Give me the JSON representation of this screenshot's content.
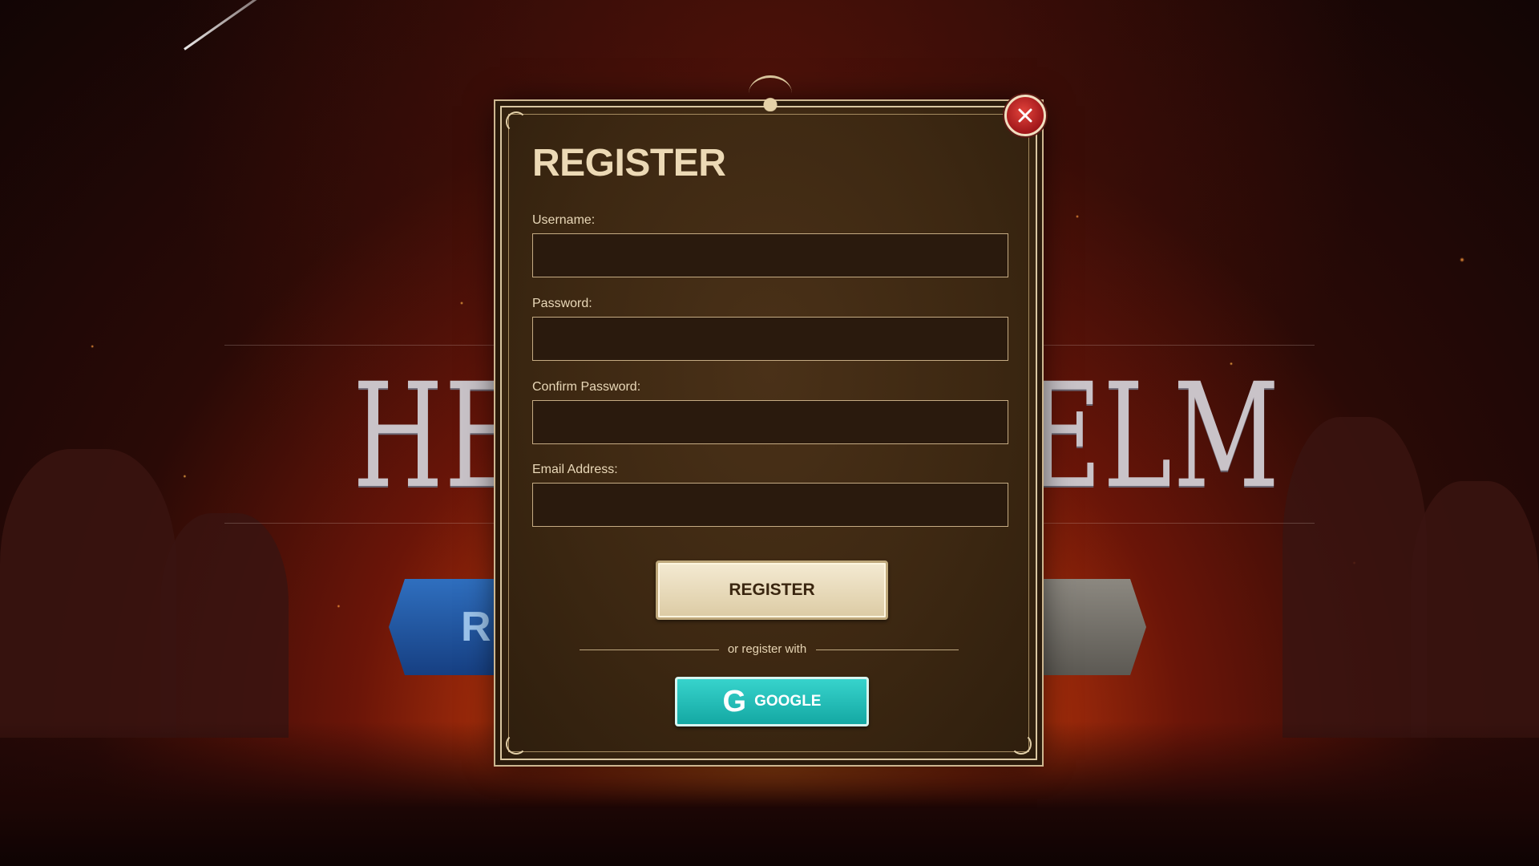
{
  "background": {
    "title_left": "HER",
    "title_right": "ELM",
    "button_left_label": "RE"
  },
  "modal": {
    "title": "REGISTER",
    "fields": [
      {
        "label": "Username:",
        "value": "",
        "placeholder": ""
      },
      {
        "label": "Password:",
        "value": "",
        "placeholder": ""
      },
      {
        "label": "Confirm Password:",
        "value": "",
        "placeholder": ""
      },
      {
        "label": "Email Address:",
        "value": "",
        "placeholder": ""
      }
    ],
    "register_button": "REGISTER",
    "divider_text": "or register with",
    "google_button": "GOOGLE",
    "google_icon_glyph": "G",
    "close_icon": "close-icon"
  },
  "colors": {
    "panel": "#3d2812",
    "accent_text": "#ecd9b5",
    "google": "#1fb8b2",
    "close": "#c12a26"
  }
}
